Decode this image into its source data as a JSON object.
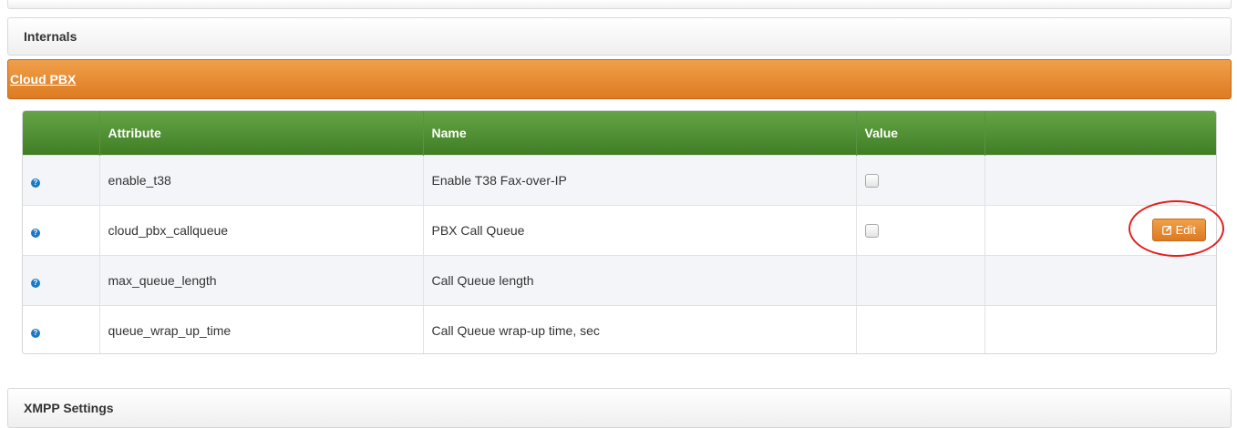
{
  "panels": {
    "internals": "Internals",
    "cloud_pbx": "Cloud PBX",
    "xmpp": "XMPP Settings"
  },
  "table": {
    "headers": [
      "",
      "Attribute",
      "Name",
      "Value",
      ""
    ],
    "rows": [
      {
        "attribute": "enable_t38",
        "name": "Enable T38 Fax-over-IP",
        "has_checkbox": true,
        "checked": false
      },
      {
        "attribute": "cloud_pbx_callqueue",
        "name": "PBX Call Queue",
        "has_checkbox": true,
        "checked": false
      },
      {
        "attribute": "max_queue_length",
        "name": "Call Queue length",
        "has_checkbox": false
      },
      {
        "attribute": "queue_wrap_up_time",
        "name": "Call Queue wrap-up time, sec",
        "has_checkbox": false
      }
    ],
    "edit_label": "Edit",
    "help_glyph": "?"
  },
  "colors": {
    "accent_orange": "#dd7b22",
    "header_green": "#3f7e24",
    "help_blue": "#1a78c4",
    "highlight_red": "#e41e1e"
  },
  "icons": {
    "help": "question-circle-icon",
    "edit": "edit-square-icon"
  }
}
